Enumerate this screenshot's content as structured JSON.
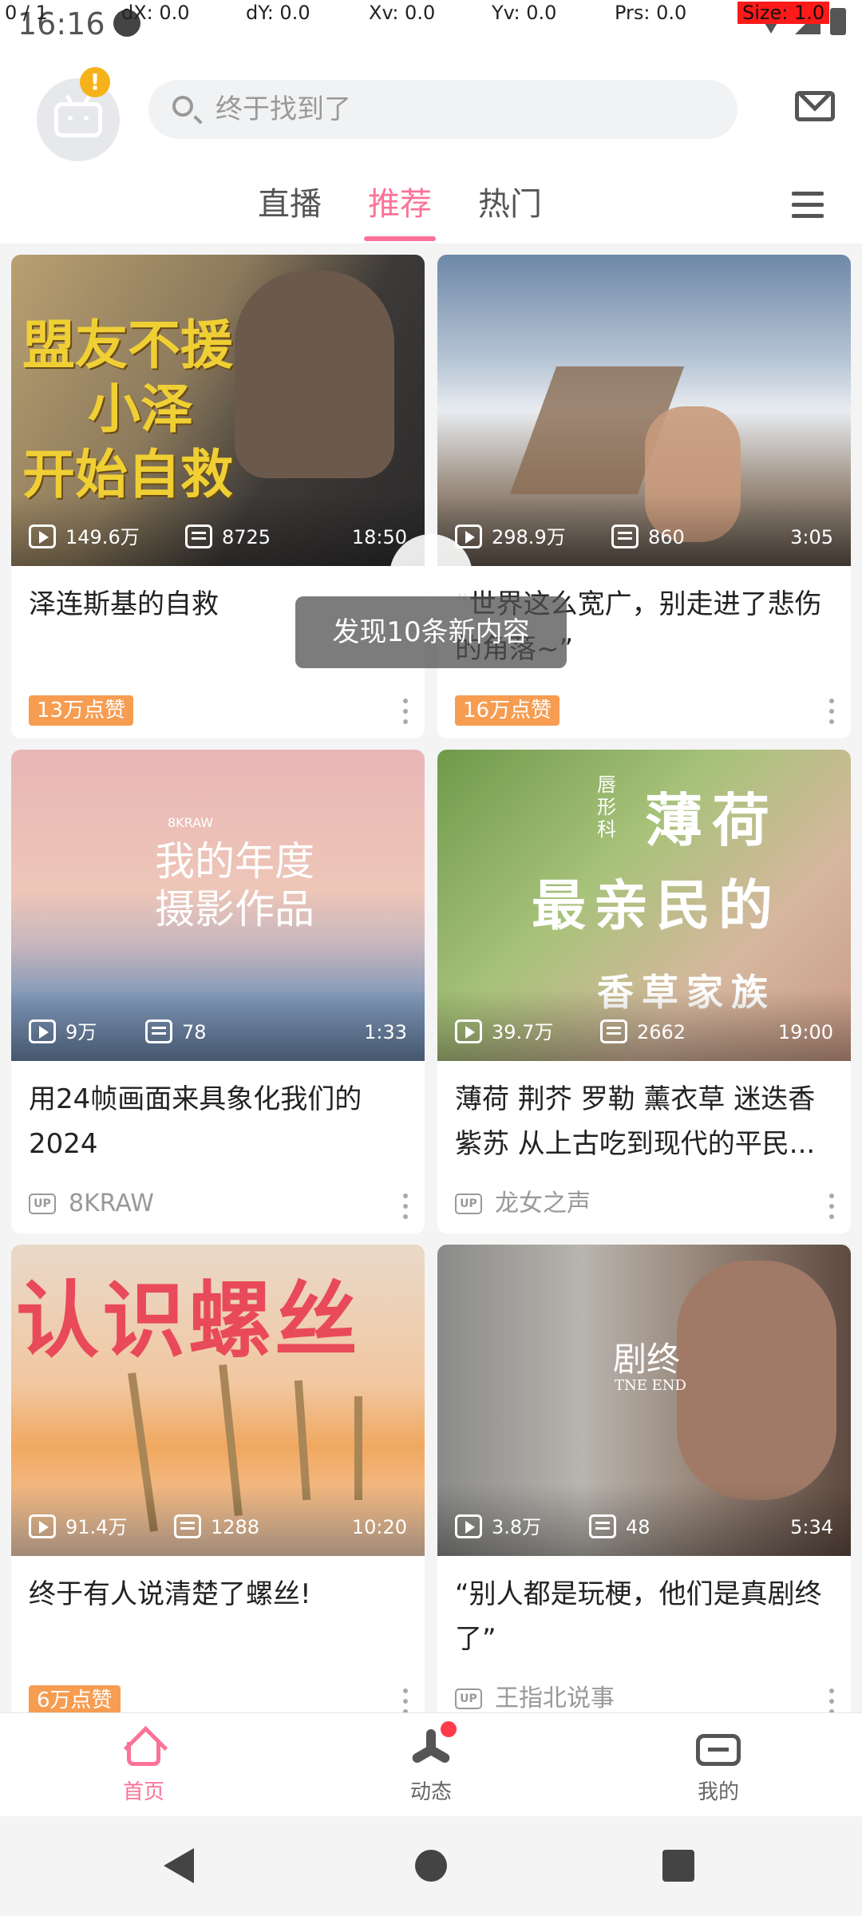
{
  "debug_overlay": {
    "pointer": "0 / 1",
    "dx": "dX: 0.0",
    "dy": "dY: 0.0",
    "xv": "Xv: 0.0",
    "yv": "Yv: 0.0",
    "prs": "Prs: 0.0",
    "size": "Size: 1.0"
  },
  "status_bar": {
    "time": "16:16"
  },
  "header": {
    "search_placeholder": "终于找到了",
    "tabs": [
      {
        "label": "直播"
      },
      {
        "label": "推荐",
        "active": true
      },
      {
        "label": "热门"
      }
    ]
  },
  "toast": {
    "text": "发现10条新内容"
  },
  "feed": {
    "cards": [
      {
        "title": "泽连斯基的自救",
        "views": "149.6万",
        "danmaku": "8725",
        "duration": "18:50",
        "badge": "13万点赞",
        "thumb_text": [
          "盟友不援",
          "小泽",
          "开始自救"
        ]
      },
      {
        "title": "“世界这么宽广，别走进了悲伤的角落~”",
        "views": "298.9万",
        "danmaku": "860",
        "duration": "3:05",
        "badge": "16万点赞"
      },
      {
        "title": "用24帧画面来具象化我们的2024",
        "views": "9万",
        "danmaku": "78",
        "duration": "1:33",
        "author": "8KRAW",
        "thumb_text": [
          "8KRAW",
          "我的年度",
          "摄影作品"
        ]
      },
      {
        "title": "薄荷 荆芥 罗勒 薰衣草 迷迭香 紫苏 从上古吃到现代的平民...",
        "views": "39.7万",
        "danmaku": "2662",
        "duration": "19:00",
        "author": "龙女之声",
        "thumb_text": [
          "唇形科",
          "薄荷",
          "最亲民的",
          "香草家族"
        ]
      },
      {
        "title": "终于有人说清楚了螺丝!",
        "views": "91.4万",
        "danmaku": "1288",
        "duration": "10:20",
        "badge": "6万点赞",
        "thumb_text": [
          "认识螺丝"
        ]
      },
      {
        "title": "“别人都是玩梗，他们是真剧终了”",
        "views": "3.8万",
        "danmaku": "48",
        "duration": "5:34",
        "author": "王指北说事",
        "thumb_text": [
          "剧终",
          "TNE END"
        ]
      }
    ],
    "up_label": "UP"
  },
  "bottom_nav": [
    {
      "label": "首页",
      "active": true
    },
    {
      "label": "动态"
    },
    {
      "label": "我的"
    }
  ],
  "colors": {
    "accent": "#fb7299",
    "badge": "#f69d52",
    "dot": "#ff3b4a"
  }
}
